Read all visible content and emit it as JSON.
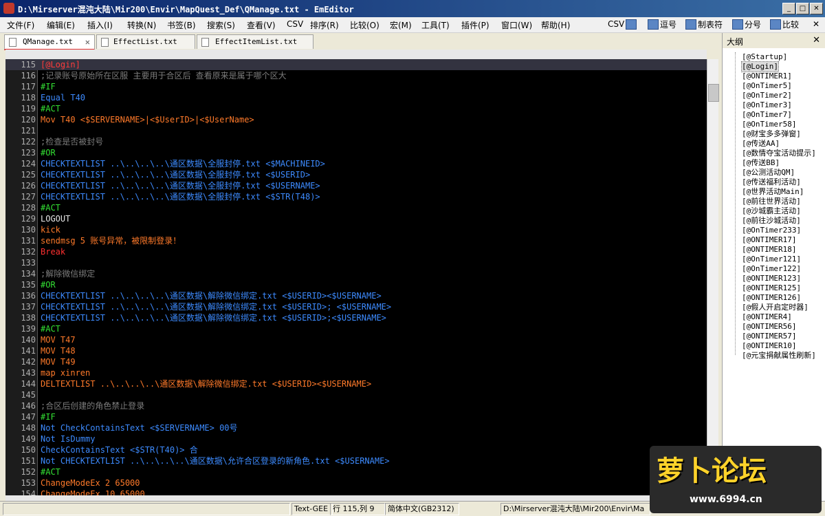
{
  "window": {
    "title": "D:\\Mirserver混沌大陆\\Mir200\\Envir\\MapQuest_Def\\QManage.txt - EmEditor",
    "minimize": "_",
    "maximize": "□",
    "close": "✕"
  },
  "menu": [
    "文件(F)",
    "编辑(E)",
    "插入(I)",
    "转换(N)",
    "书签(B)",
    "搜索(S)",
    "查看(V)",
    "CSV",
    "排序(R)",
    "比较(O)",
    "宏(M)",
    "工具(T)",
    "插件(P)",
    "窗口(W)",
    "帮助(H)"
  ],
  "toolbar": {
    "csv": "CSV",
    "comma": "逗号",
    "tab": "制表符",
    "semicolon": "分号",
    "compare": "比较",
    "close": "✕"
  },
  "tabs": [
    {
      "label": "QManage.txt",
      "close": "✕"
    },
    {
      "label": "EffectList.txt"
    },
    {
      "label": "EffectItemList.txt"
    }
  ],
  "editor": {
    "lines": [
      {
        "n": "115",
        "t": "[@Login]",
        "c": "label"
      },
      {
        "n": "116",
        "t": ";记录账号原始所在区服 主要用于合区后 查看原来是属于哪个区大",
        "c": "comment"
      },
      {
        "n": "117",
        "t": "#IF",
        "c": "section"
      },
      {
        "n": "118",
        "t": "Equal T40",
        "c": "cond"
      },
      {
        "n": "119",
        "t": "#ACT",
        "c": "section"
      },
      {
        "n": "120",
        "t": "Mov T40 <$SERVERNAME>|<$UserID>|<$UserName>",
        "c": "action"
      },
      {
        "n": "121",
        "t": "",
        "c": "plain"
      },
      {
        "n": "122",
        "t": ";检查是否被封号",
        "c": "comment"
      },
      {
        "n": "123",
        "t": "#OR",
        "c": "section"
      },
      {
        "n": "124",
        "t": "CHECKTEXTLIST ..\\..\\..\\..\\通区数据\\全服封停.txt <$MACHINEID>",
        "c": "cond"
      },
      {
        "n": "125",
        "t": "CHECKTEXTLIST ..\\..\\..\\..\\通区数据\\全服封停.txt <$USERID>",
        "c": "cond"
      },
      {
        "n": "126",
        "t": "CHECKTEXTLIST ..\\..\\..\\..\\通区数据\\全服封停.txt <$USERNAME>",
        "c": "cond"
      },
      {
        "n": "127",
        "t": "CHECKTEXTLIST ..\\..\\..\\..\\通区数据\\全服封停.txt <$STR(T48)>",
        "c": "cond"
      },
      {
        "n": "128",
        "t": "#ACT",
        "c": "section"
      },
      {
        "n": "129",
        "t": "LOGOUT",
        "c": "plain"
      },
      {
        "n": "130",
        "t": "kick",
        "c": "action"
      },
      {
        "n": "131",
        "t": "sendmsg 5 账号异常，被限制登录！",
        "c": "action"
      },
      {
        "n": "132",
        "t": "Break",
        "c": "break"
      },
      {
        "n": "133",
        "t": "",
        "c": "plain"
      },
      {
        "n": "134",
        "t": ";解除微信绑定",
        "c": "comment"
      },
      {
        "n": "135",
        "t": "#OR",
        "c": "section"
      },
      {
        "n": "136",
        "t": "CHECKTEXTLIST ..\\..\\..\\..\\通区数据\\解除微信绑定.txt <$USERID><$USERNAME>",
        "c": "cond"
      },
      {
        "n": "137",
        "t": "CHECKTEXTLIST ..\\..\\..\\..\\通区数据\\解除微信绑定.txt <$USERID>; <$USERNAME>",
        "c": "cond"
      },
      {
        "n": "138",
        "t": "CHECKTEXTLIST ..\\..\\..\\..\\通区数据\\解除微信绑定.txt <$USERID>;<$USERNAME>",
        "c": "cond"
      },
      {
        "n": "139",
        "t": "#ACT",
        "c": "section"
      },
      {
        "n": "140",
        "t": "MOV T47",
        "c": "action"
      },
      {
        "n": "141",
        "t": "MOV T48",
        "c": "action"
      },
      {
        "n": "142",
        "t": "MOV T49",
        "c": "action"
      },
      {
        "n": "143",
        "t": "map xinren",
        "c": "action"
      },
      {
        "n": "144",
        "t": "DELTEXTLIST ..\\..\\..\\..\\通区数据\\解除微信绑定.txt <$USERID><$USERNAME>",
        "c": "action"
      },
      {
        "n": "145",
        "t": "",
        "c": "plain"
      },
      {
        "n": "146",
        "t": ";合区后创建的角色禁止登录",
        "c": "comment"
      },
      {
        "n": "147",
        "t": "#IF",
        "c": "section"
      },
      {
        "n": "148",
        "t": "Not CheckContainsText <$SERVERNAME> 00号",
        "c": "cond"
      },
      {
        "n": "149",
        "t": "Not IsDummy",
        "c": "cond"
      },
      {
        "n": "150",
        "t": "CheckContainsText <$STR(T40)> 合",
        "c": "cond"
      },
      {
        "n": "151",
        "t": "Not CHECKTEXTLIST ..\\..\\..\\..\\通区数据\\允许合区登录的新角色.txt <$USERNAME>",
        "c": "cond"
      },
      {
        "n": "152",
        "t": "#ACT",
        "c": "section"
      },
      {
        "n": "153",
        "t": "ChangeModeEx 2 65000",
        "c": "action"
      },
      {
        "n": "154",
        "t": "ChangeModeEx 10 65000",
        "c": "action"
      }
    ]
  },
  "outline": {
    "title": "大纲",
    "close": "✕",
    "items": [
      "[@Startup]",
      "[@Login]",
      "[@ONTIMER1]",
      "[@OnTimer5]",
      "[@OnTimer2]",
      "[@OnTimer3]",
      "[@OnTimer7]",
      "[@OnTimer58]",
      "[@财宝多多弹窗]",
      "[@传送AA]",
      "[@数情夺宝活动提示]",
      "[@传送BB]",
      "[@公测活动QM]",
      "[@传送福利活动]",
      "[@世界活动Main]",
      "[@前往世界活动]",
      "[@沙城霸主活动]",
      "[@前往沙城活动]",
      "[@OnTimer233]",
      "[@ONTIMER17]",
      "[@ONTIMER18]",
      "[@OnTimer121]",
      "[@OnTimer122]",
      "[@ONTIMER123]",
      "[@ONTIMER125]",
      "[@ONTIMER126]",
      "[@假人开启定时器]",
      "[@ONTIMER4]",
      "[@ONTIMER56]",
      "[@ONTIMER57]",
      "[@ONTIMER10]",
      "[@元宝捐献属性刷新]"
    ]
  },
  "status": {
    "mode": "Text-GEE",
    "position": "行 115,列 9",
    "encoding": "简体中文(GB2312)",
    "path": "D:\\Mirserver混沌大陆\\Mir200\\Envir\\Ma"
  },
  "watermark": {
    "brand": "萝卜论坛",
    "url": "www.6994.cn"
  }
}
